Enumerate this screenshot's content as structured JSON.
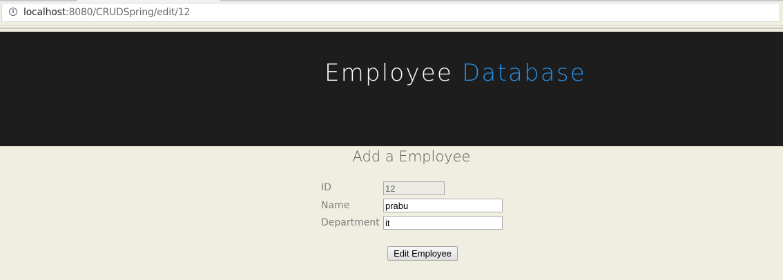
{
  "browser": {
    "url_host": "localhost",
    "url_path": ":8080/CRUDSpring/edit/12",
    "info_icon": "info-icon"
  },
  "header": {
    "title_main": "Employee",
    "title_accent": "Database",
    "accent_color": "#2a8ee6",
    "background_color": "#1d1d1d"
  },
  "form": {
    "heading": "Add a Employee",
    "fields": {
      "id": {
        "label": "ID",
        "value": "12",
        "readonly": true
      },
      "name": {
        "label": "Name",
        "value": "prabu"
      },
      "department": {
        "label": "Department",
        "value": "it"
      }
    },
    "submit_label": "Edit Employee"
  }
}
